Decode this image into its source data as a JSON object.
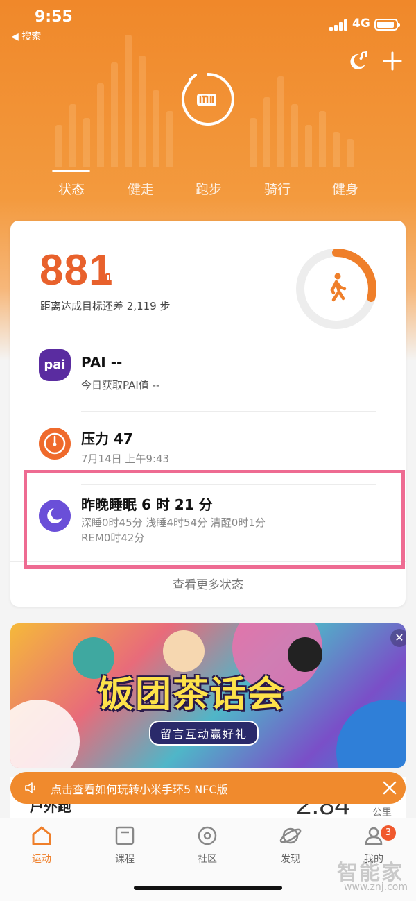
{
  "status_bar": {
    "time": "9:55",
    "back_label": "◀ 搜索",
    "network": "4G"
  },
  "tabs": [
    {
      "label": "状态"
    },
    {
      "label": "健走"
    },
    {
      "label": "跑步"
    },
    {
      "label": "骑行"
    },
    {
      "label": "健身"
    }
  ],
  "active_tab": "状态",
  "steps": {
    "count": "881",
    "remaining_text": "距离达成目标还差 2,119 步",
    "progress_fraction": 0.29
  },
  "pai": {
    "icon_text": "pai",
    "title": "PAI --",
    "subtitle": "今日获取PAI值 --"
  },
  "stress": {
    "title": "压力 47",
    "time": "7月14日 上午9:43"
  },
  "sleep": {
    "title": "昨晚睡眠 6 时 21 分",
    "detail_line1": "深睡0时45分 浅睡4时54分 清醒0时1分",
    "detail_line2": "REM0时42分"
  },
  "more_status": "查看更多状态",
  "banner": {
    "title": "饭团茶话会",
    "subtitle": "留言互动赢好礼"
  },
  "notice": {
    "text": "点击查看如何玩转小米手环5 NFC版"
  },
  "peek": {
    "label": "户外跑",
    "value": "2.84",
    "unit": "公里"
  },
  "bottom_nav": [
    {
      "label": "运动"
    },
    {
      "label": "课程"
    },
    {
      "label": "社区"
    },
    {
      "label": "发现"
    },
    {
      "label": "我的",
      "badge": "3"
    }
  ],
  "watermark": {
    "text": "智能家",
    "url": "www.znj.com"
  },
  "colors": {
    "accent": "#ef7f2a",
    "steps": "#e8612c",
    "pai": "#5a2ca0",
    "sleep": "#6a4fd8",
    "highlight": "#ee6b92"
  }
}
